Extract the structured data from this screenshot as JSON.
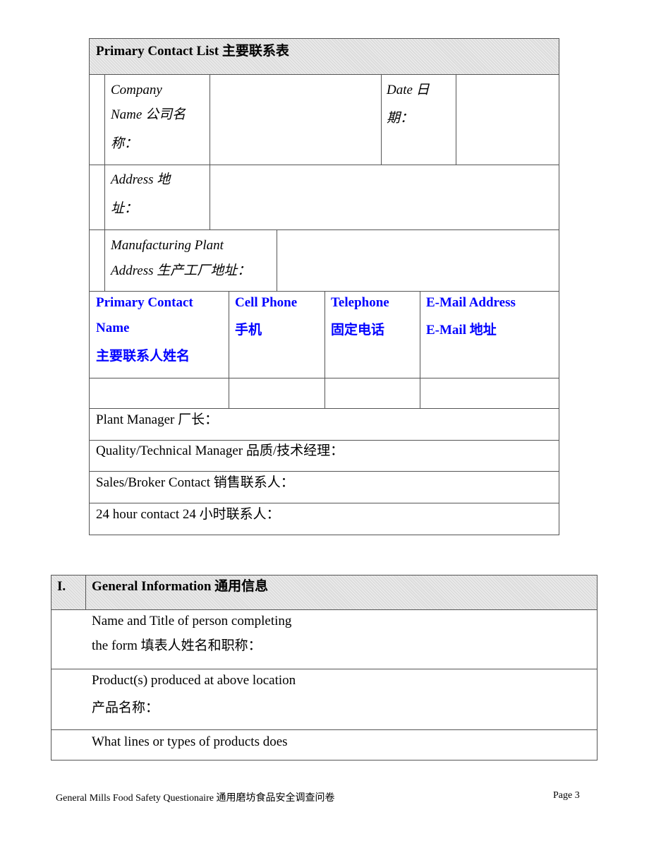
{
  "contact_list": {
    "title": "Primary Contact List 主要联系表",
    "company_label_1": "Company",
    "company_label_2": "Name 公司名",
    "company_label_3": "称：",
    "company_value": "",
    "date_label_1": "Date 日",
    "date_label_2": "期：",
    "date_value": "",
    "address_label_1": "Address 地",
    "address_label_2": "址：",
    "address_value": "",
    "plant_label_1": "Manufacturing Plant",
    "plant_label_2": "Address 生产工厂地址：",
    "plant_value": "",
    "columns": [
      {
        "line1": "Primary Contact",
        "line2": "Name",
        "line3": "主要联系人姓名"
      },
      {
        "line1": "Cell Phone",
        "line2": "手机"
      },
      {
        "line1": "Telephone",
        "line2": "固定电话"
      },
      {
        "line1": "E-Mail Address",
        "line2": "E-Mail 地址"
      }
    ],
    "contact_row": [
      "",
      "",
      "",
      ""
    ],
    "roles": [
      "Plant Manager 厂长：",
      "Quality/Technical Manager 品质/技术经理：",
      "Sales/Broker Contact 销售联系人：",
      "24 hour contact 24 小时联系人："
    ],
    "header_color": "#0000ff"
  },
  "general_info": {
    "number": "I.",
    "title": "General Information 通用信息",
    "q1_line1": "Name and Title of person completing",
    "q1_line2": "the form 填表人姓名和职称：",
    "q2_line1": "Product(s) produced at above location",
    "q2_line2": "产品名称：",
    "q3_line1": "What lines or types of products does"
  },
  "footer": {
    "doc_title": "General Mills Food Safety Questionaire 通用磨坊食品安全调查问卷",
    "page": "Page 3"
  }
}
